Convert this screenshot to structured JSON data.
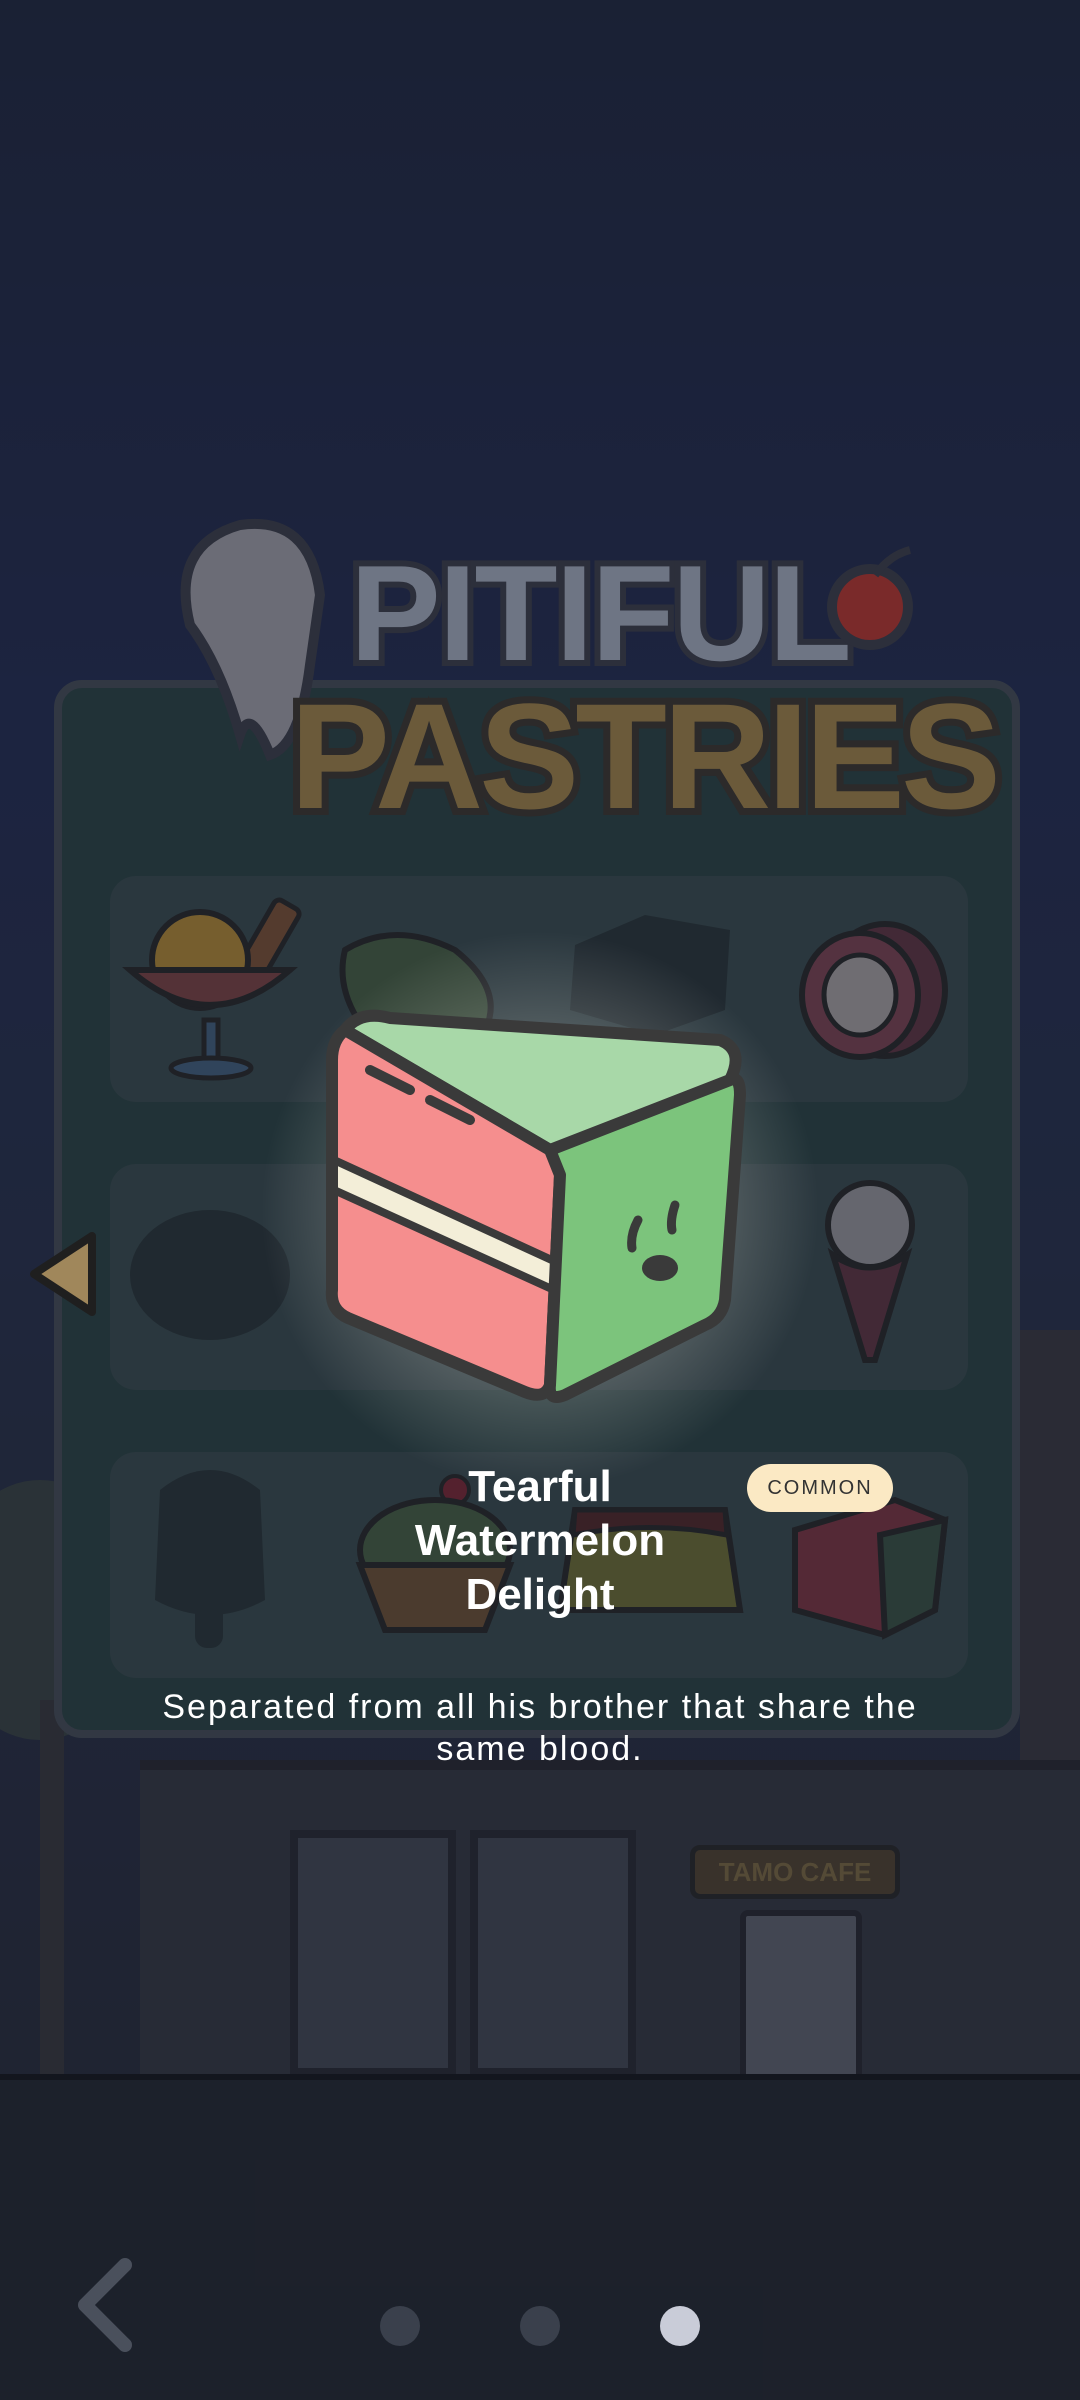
{
  "title": {
    "line1": "PITIFUL",
    "line2": "PASTRIES"
  },
  "selected_item": {
    "name": "Tearful Watermelon Delight",
    "rarity": "COMMON",
    "description": "Separated from all his brother that share the same blood."
  },
  "background": {
    "cafe_sign": "TAMO CAFE"
  },
  "grid_items": [
    [
      "ice-cream-sundae",
      "leaf-dessert",
      "locked",
      "swiss-roll"
    ],
    [
      "locked",
      "locked",
      "locked",
      "ice-cream-cone"
    ],
    [
      "locked-popsicle",
      "cherry-tart",
      "pudding",
      "watermelon-cake"
    ]
  ],
  "pager": {
    "page_count": 3,
    "active_index": 2
  },
  "colors": {
    "badge_bg": "#fbe9c4",
    "panel": "#2f4a4a",
    "accent_arrow": "#a0875b"
  }
}
